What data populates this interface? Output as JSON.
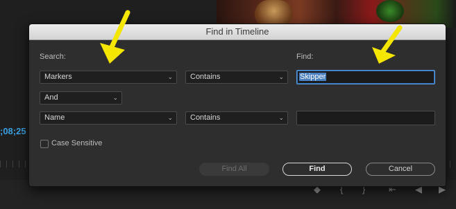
{
  "dialog": {
    "title": "Find in Timeline",
    "search_label": "Search:",
    "find_label": "Find:",
    "row1": {
      "field": "Markers",
      "operator": "Contains",
      "value": "Skipper"
    },
    "combiner": "And",
    "row2": {
      "field": "Name",
      "operator": "Contains",
      "value": ""
    },
    "case_sensitive_label": "Case Sensitive",
    "case_sensitive_checked": false,
    "buttons": {
      "find_all": "Find All",
      "find": "Find",
      "cancel": "Cancel"
    }
  },
  "background": {
    "timecode": ";08;25"
  },
  "annotations": {
    "arrow_color": "#f5e600"
  }
}
